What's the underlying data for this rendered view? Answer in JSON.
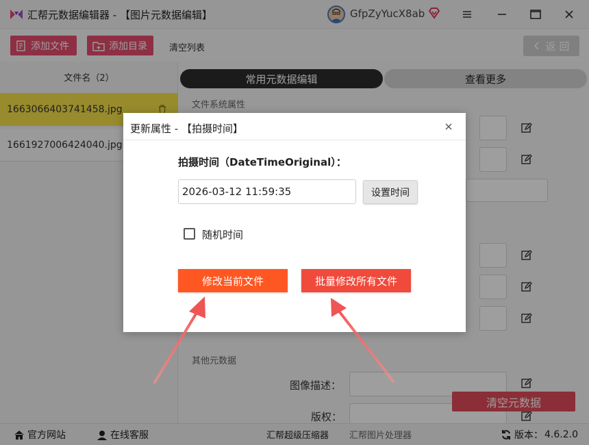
{
  "app": {
    "title": "汇帮元数据编辑器 - 【图片元数据编辑】",
    "username": "GfpZyYucX8ab"
  },
  "toolbar": {
    "add_file": "添加文件",
    "add_dir": "添加目录",
    "clear_list": "清空列表",
    "back": "返 回"
  },
  "files": {
    "header": "文件名（2）",
    "items": [
      "1663066403741458.jpg",
      "1661927006424040.jpg"
    ]
  },
  "tabs": {
    "common": "常用元数据编辑",
    "more": "查看更多"
  },
  "sections": {
    "filesystem": "文件系统属性",
    "other": "其他元数据"
  },
  "fields": {
    "image_desc": "图像描述：",
    "copyright": "版权："
  },
  "clear_metadata": "清空元数据",
  "dialog": {
    "title": "更新属性 - 【拍摄时间】",
    "field_label": "拍摄时间（DateTimeOriginal）：",
    "datetime_value": "2026-03-12 11:59:35",
    "set_time": "设置时间",
    "random_time": "随机时间",
    "modify_current": "修改当前文件",
    "batch_modify": "批量修改所有文件"
  },
  "status": {
    "website": "官方网站",
    "support": "在线客服",
    "compressor": "汇帮超级压缩器",
    "image_tool": "汇帮图片处理器",
    "version_label": "版本：",
    "version": "4.6.2.0"
  },
  "colors": {
    "accent_pink": "#e54d6f",
    "selected_row": "#f4e14a",
    "orange_button": "#ff5722",
    "arrow": "#f06a6a"
  }
}
